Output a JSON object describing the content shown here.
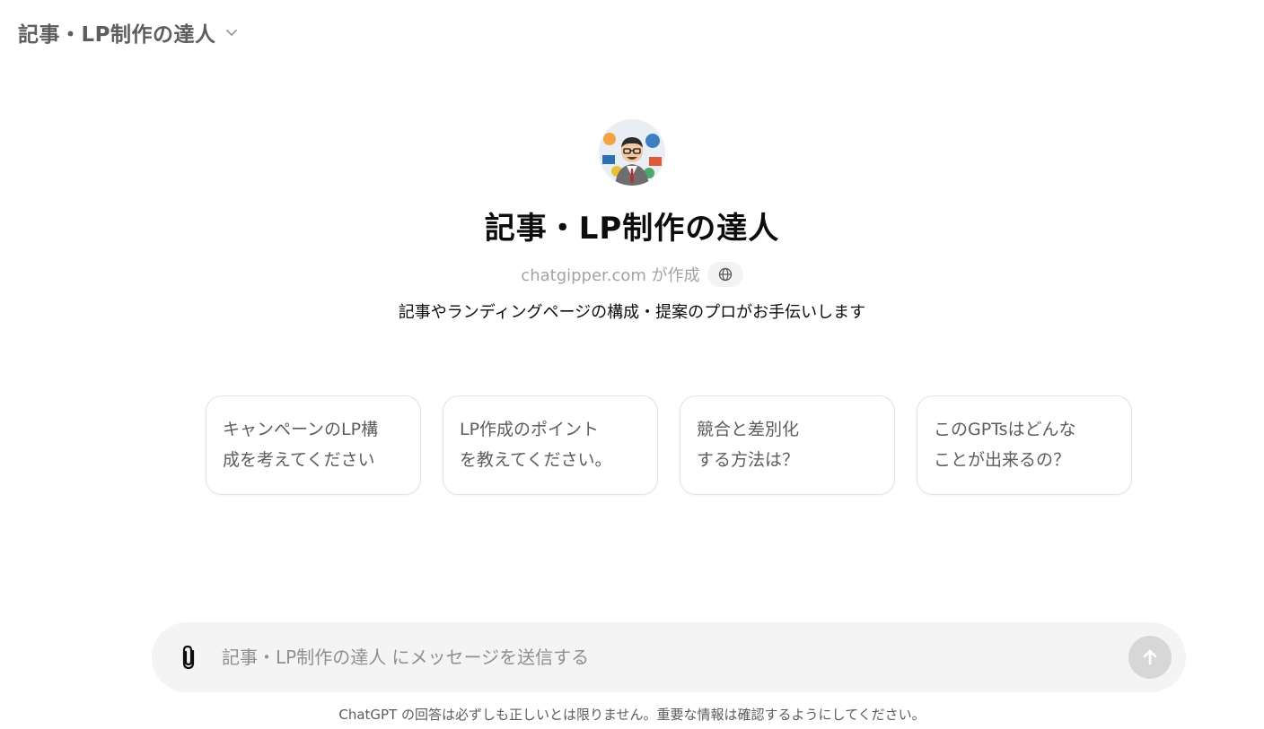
{
  "header": {
    "title": "記事・LP制作の達人"
  },
  "hero": {
    "name": "記事・LP制作の達人",
    "creator": "chatgipper.com が作成",
    "description": "記事やランディングページの構成・提案のプロがお手伝いします",
    "avatar_icon": "avatar-man-with-glasses-illustration",
    "badge_icon": "globe-icon"
  },
  "suggestions": [
    {
      "text": "キャンペーンのLP構\n成を考えてください"
    },
    {
      "text": "LP作成のポイント\nを教えてください。"
    },
    {
      "text": "競合と差別化\nする方法は？"
    },
    {
      "text": "このGPTsはどんな\nことが出来るの？"
    }
  ],
  "composer": {
    "placeholder": "記事・LP制作の達人 にメッセージを送信する",
    "attach_icon": "paperclip-icon",
    "send_icon": "arrow-up-icon"
  },
  "footer": {
    "disclaimer": "ChatGPT の回答は必ずしも正しいとは限りません。重要な情報は確認するようにしてください。"
  },
  "colors": {
    "text_primary": "#0d0d0d",
    "text_secondary": "#5d5d5d",
    "composer_bg": "#f4f4f4",
    "send_disabled": "#d7d7d7"
  }
}
